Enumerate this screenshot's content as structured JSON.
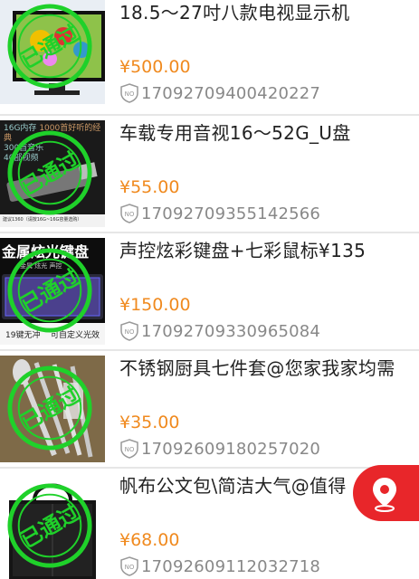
{
  "colors": {
    "price": "#f08a1f",
    "stamp": "#1fd12a",
    "fab": "#e8262a",
    "code": "#888888"
  },
  "stamp_text": "已通过",
  "items": [
    {
      "title": "18.5～27吋八款电视显示机",
      "price": "¥500.00",
      "code": "17092709400420227",
      "thumb_icon": "tv-monitor-thumbnail"
    },
    {
      "title": "车载专用音视16～52G_U盘",
      "price": "¥55.00",
      "code": "17092709355142566",
      "thumb_icon": "usb-drive-thumbnail",
      "thumb_texts": [
        "16G内存",
        "300首音乐",
        "40部视频",
        "1000首好听的经典",
        "建议1360（请按16G~16G容量选购）"
      ]
    },
    {
      "title": "声控炫彩键盘+七彩鼠标¥135",
      "price": "¥150.00",
      "code": "17092709330965084",
      "thumb_icon": "keyboard-thumbnail",
      "thumb_texts": [
        "金属炫光键盘",
        "金属 炫光 声控",
        "19键无冲",
        "可自定义光效"
      ]
    },
    {
      "title": "不锈钢厨具七件套@您家我家均需",
      "price": "¥35.00",
      "code": "17092609180257020",
      "thumb_icon": "kitchen-tools-thumbnail"
    },
    {
      "title": "帆布公文包\\简洁大气@值得",
      "price": "¥68.00",
      "code": "17092609112032718",
      "thumb_icon": "canvas-bag-thumbnail"
    }
  ],
  "fab_icon": "location-pin-icon"
}
